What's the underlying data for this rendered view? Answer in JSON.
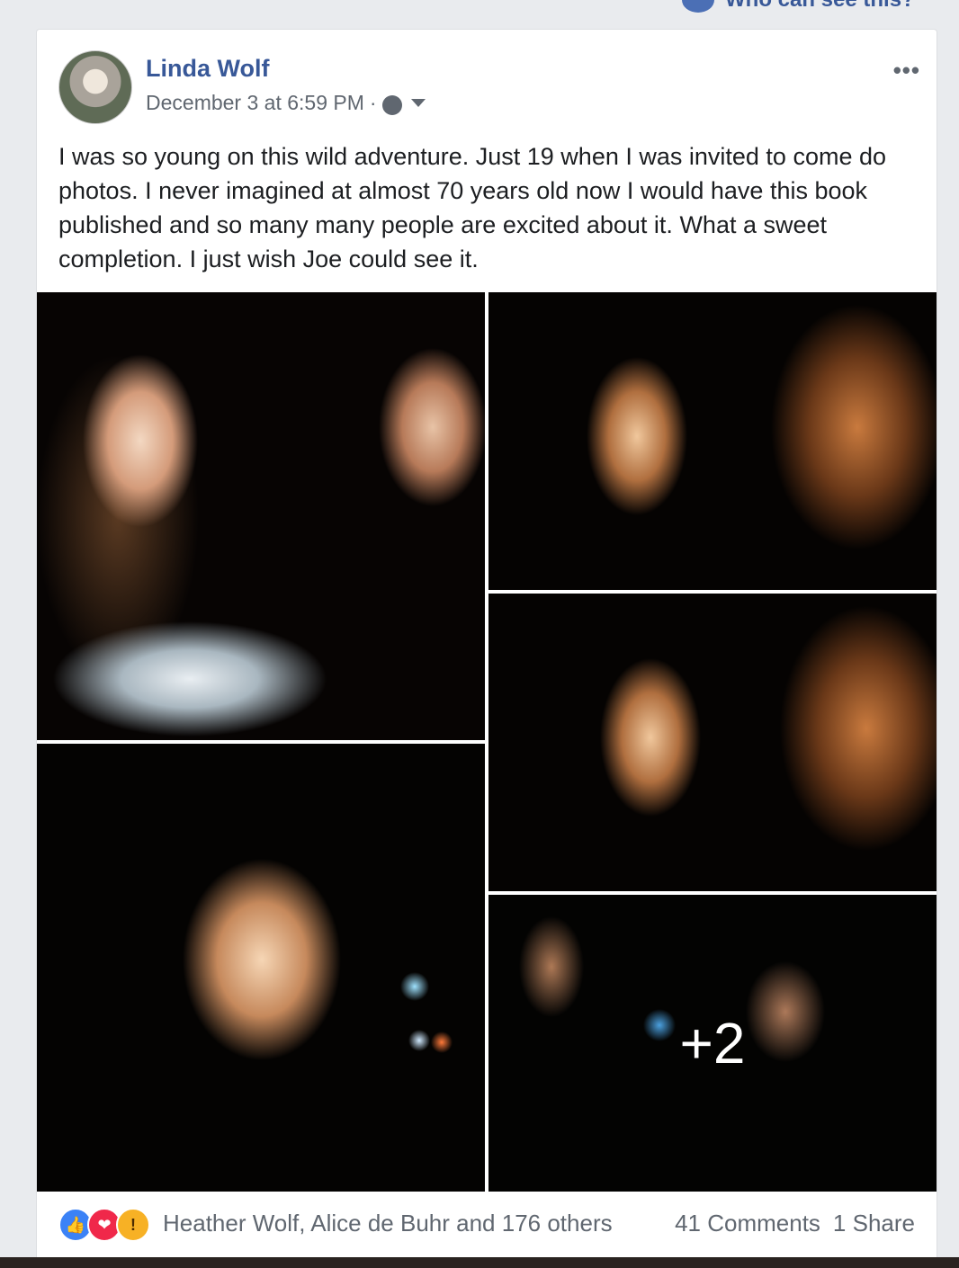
{
  "top": {
    "who_can_see": "Who can see this?"
  },
  "post": {
    "author": "Linda Wolf",
    "timestamp": "December 3 at 6:59 PM",
    "separator": "·",
    "privacy_icon": "globe-icon",
    "more_icon": "more-icon",
    "text": "I was so young on this wild adventure. Just 19 when I was invited to come do photos. I never imagined at almost 70 years old now I would have this book published and so many many people are excited about it. What a sweet completion. I just wish Joe could see it.",
    "more_label": "•••"
  },
  "photos": {
    "overlay": "+2"
  },
  "footer": {
    "reactions": [
      "like",
      "love",
      "wow"
    ],
    "reaction_names": "Heather Wolf, Alice de Buhr and 176 others",
    "comments": "41 Comments",
    "shares": "1 Share"
  }
}
